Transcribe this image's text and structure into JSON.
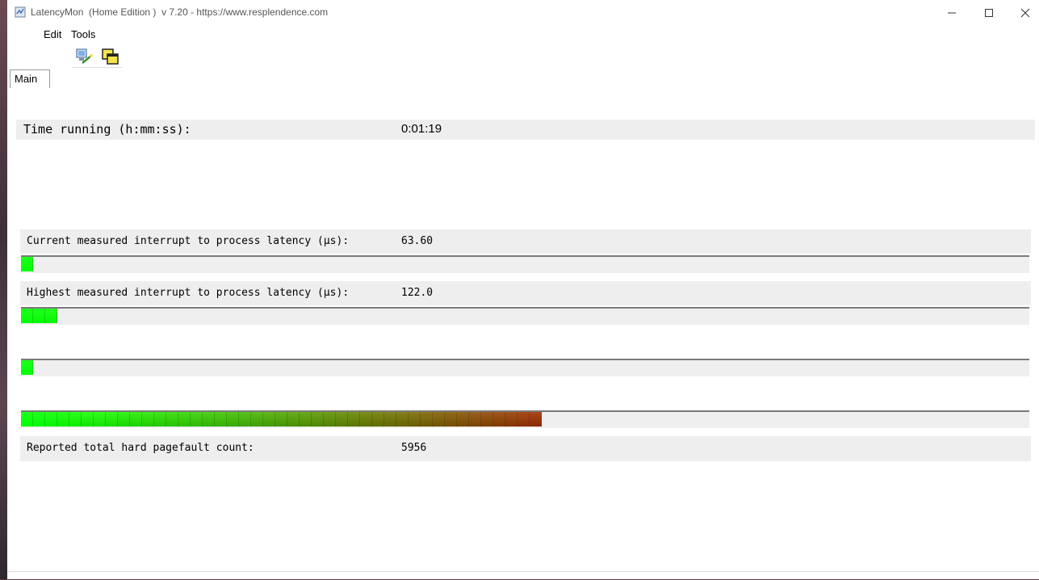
{
  "window": {
    "title": "LatencyMon  (Home Edition )  v 7.20 - https://www.resplendence.com"
  },
  "menu": {
    "edit": "Edit",
    "tools": "Tools"
  },
  "toolbar": {
    "start_icon": "monitor-wand-icon",
    "stop_icon": "windows-stack-icon"
  },
  "tabs": {
    "main": "Main"
  },
  "stats": {
    "time_running_label": "Time running (h:mm:ss):",
    "time_running_value": "0:01:19",
    "current_latency_label": "Current measured interrupt to process latency (µs):",
    "current_latency_value": "63.60",
    "highest_latency_label": "Highest measured interrupt to process latency (µs):",
    "highest_latency_value": "122.0",
    "pagefault_label": "Reported total hard pagefault count:",
    "pagefault_value": "5956"
  },
  "bars": {
    "current_segments": 1,
    "highest_segments": 3,
    "third_segments": 1,
    "pagefault_segments": 43
  },
  "colors": {
    "bar_start": "#00ff00",
    "bar_end": "#8b2a00"
  }
}
